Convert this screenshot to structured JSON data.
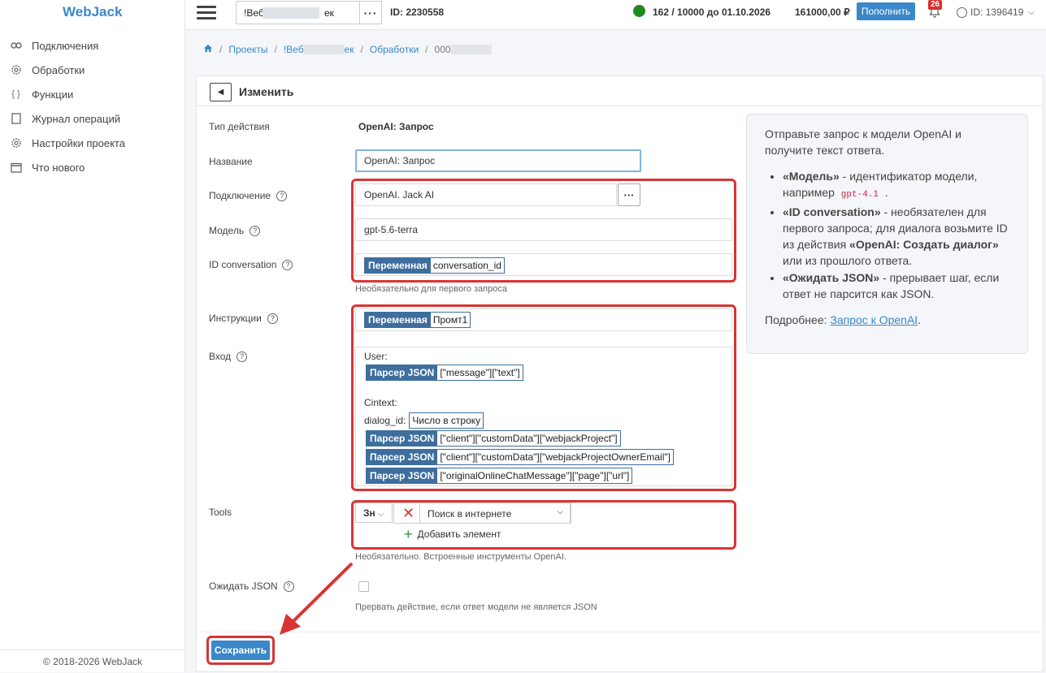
{
  "app": {
    "logo": "WebJack"
  },
  "sidebar": {
    "items": [
      {
        "label": "Подключения",
        "icon": "link-icon"
      },
      {
        "label": "Обработки",
        "icon": "gear-icon"
      },
      {
        "label": "Функции",
        "icon": "braces-icon"
      },
      {
        "label": "Журнал операций",
        "icon": "document-icon"
      },
      {
        "label": "Настройки проекта",
        "icon": "gear-icon"
      },
      {
        "label": "Что нового",
        "icon": "calendar-icon"
      }
    ],
    "copyright": "© 2018-2026 WebJack"
  },
  "topbar": {
    "project_name": "!Веб",
    "project_suffix": "ек",
    "project_id": "ID: 2230558",
    "limits": "162 / 10000 до 01.10.2026",
    "balance": "161000,00 ₽",
    "topup_label": "Пополнить",
    "notifications": "26",
    "user_id": "ID: 1396419"
  },
  "breadcrumb": {
    "items": [
      "Проекты",
      "!Веб",
      "ек",
      "Обработки",
      "000"
    ]
  },
  "card": {
    "title": "Изменить"
  },
  "form": {
    "action_type_label": "Тип действия",
    "action_type_value": "OpenAI: Запрос",
    "name_label": "Название",
    "name_value": "OpenAI: Запрос",
    "connection_label": "Подключение",
    "connection_value": "OpenAI. Jack AI",
    "model_label": "Модель",
    "model_value": "gpt-5.6-terra",
    "conv_label": "ID conversation",
    "conv_chip_key": "Переменная",
    "conv_chip_val": "conversation_id",
    "conv_hint": "Необязательно для первого запроса",
    "instr_label": "Инструкции",
    "instr_chip_key": "Переменная",
    "instr_chip_val": "Промт1",
    "input_label": "Вход",
    "input_user": "User:",
    "parser_key": "Парсер JSON",
    "input_chip1": "[\"message\"][\"text\"]",
    "input_context": "Cintext:",
    "input_dialog": "dialog_id:",
    "input_dialog_chip": "Число в строку",
    "input_chip2": "[\"client\"][\"customData\"][\"webjackProject\"]",
    "input_chip3": "[\"client\"][\"customData\"][\"webjackProjectOwnerEmail\"]",
    "input_chip4": "[\"originalOnlineChatMessage\"][\"page\"][\"url\"]",
    "tools_label": "Tools",
    "tools_cond": "Зн",
    "tools_item": "Поиск в интернете",
    "tools_add": "Добавить элемент",
    "tools_hint": "Необязательно. Встроенные инструменты OpenAI.",
    "json_label": "Ожидать JSON",
    "json_hint": "Прервать действие, если ответ модели не является JSON",
    "save_label": "Сохранить"
  },
  "info": {
    "intro": "Отправьте запрос к модели OpenAI и получите текст ответа.",
    "b1_title": "«Модель»",
    "b1_text": " - идентификатор модели, например ",
    "b1_code": "gpt-4.1",
    "b1_end": " .",
    "b2_title": "«ID conversation»",
    "b2_text": " - необязателен для первого запроса; для диалога возьмите ID из действия ",
    "b2_bold": "«OpenAI: Создать диалог»",
    "b2_end": " или из прошлого ответа.",
    "b3_title": "«Ожидать JSON»",
    "b3_text": " - прерывает шаг, если ответ не парсится как JSON.",
    "more": "Подробнее: ",
    "more_link": "Запрос к OpenAI",
    "more_end": "."
  },
  "colors": {
    "accent": "#3a87c9",
    "highlight": "#d93434",
    "status": "#1e8a1e"
  }
}
